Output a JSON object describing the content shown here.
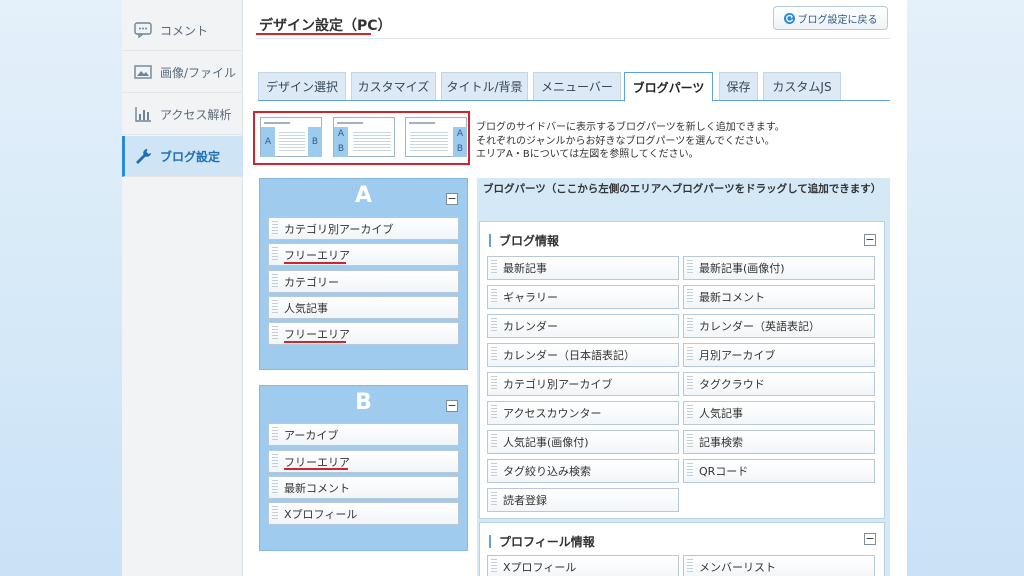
{
  "sidebar": {
    "items": [
      {
        "label": "コメント",
        "icon": "comment-icon"
      },
      {
        "label": "画像/ファイル",
        "icon": "image-icon"
      },
      {
        "label": "アクセス解析",
        "icon": "chart-icon"
      },
      {
        "label": "ブログ設定",
        "icon": "wrench-icon"
      }
    ]
  },
  "header": {
    "title": "デザイン設定（PC）",
    "back_label": "ブログ設定に戻る"
  },
  "tabs": [
    "デザイン選択",
    "カスタマイズ",
    "タイトル/背景",
    "メニューバー",
    "ブログパーツ",
    "保存",
    "カスタムJS"
  ],
  "active_tab": "ブログパーツ",
  "layouts": {
    "a": "A",
    "b": "B"
  },
  "description": [
    "ブログのサイドバーに表示するブログパーツを新しく追加できます。",
    "それぞれのジャンルからお好きなブログパーツを選んでください。",
    "エリアA・Bについては左図を参照してください。"
  ],
  "area_a": {
    "letter": "A",
    "minus": "−",
    "items": [
      "カテゴリ別アーカイブ",
      "フリーエリア",
      "カテゴリー",
      "人気記事",
      "フリーエリア"
    ]
  },
  "area_b": {
    "letter": "B",
    "minus": "−",
    "items": [
      "アーカイブ",
      "フリーエリア",
      "最新コメント",
      "Xプロフィール"
    ]
  },
  "available": {
    "title": "ブログパーツ（ここから左側のエリアへブログパーツをドラッグして追加できます）",
    "groups": [
      {
        "title": "ブログ情報",
        "minus": "−",
        "items": [
          "最新記事",
          "最新記事(画像付)",
          "ギャラリー",
          "最新コメント",
          "カレンダー",
          "カレンダー（英語表記）",
          "カレンダー（日本語表記）",
          "月別アーカイブ",
          "カテゴリ別アーカイブ",
          "タグクラウド",
          "アクセスカウンター",
          "人気記事",
          "人気記事(画像付)",
          "記事検索",
          "タグ絞り込み検索",
          "QRコード",
          "読者登録"
        ]
      },
      {
        "title": "プロフィール情報",
        "minus": "−",
        "items": [
          "Xプロフィール",
          "メンバーリスト"
        ]
      }
    ]
  },
  "colors": {
    "accent": "#2b8ad6",
    "panel": "#9fcbee",
    "highlight_red": "#d0252e"
  }
}
